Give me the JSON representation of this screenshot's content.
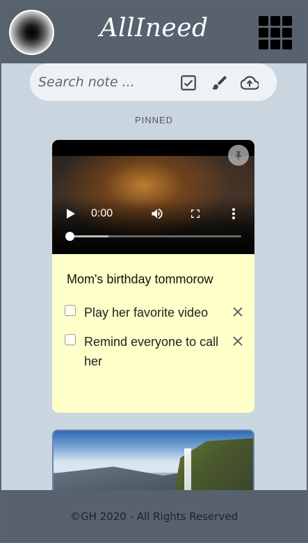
{
  "header": {
    "brand": "AllIneed",
    "avatar_icon": "avatar-image",
    "apps_icon": "grid-apps-icon"
  },
  "search": {
    "placeholder": "Search note ...",
    "actions": [
      "checkbox-note-icon",
      "brush-icon",
      "cloud-upload-icon"
    ]
  },
  "section": {
    "pinned_label": "PINNED"
  },
  "note": {
    "video": {
      "time": "0:00",
      "progress_fraction": 0.0,
      "buffered_fraction": 0.23
    },
    "pin_icon": "pin-icon",
    "title": "Mom's birthday tommorow",
    "items": [
      {
        "text": "Play her favorite video",
        "checked": false
      },
      {
        "text": "Remind everyone to call her",
        "checked": false
      }
    ],
    "background": "#ffffc9"
  },
  "footer": {
    "copyright": "©GH 2020 - All Rights Reserved"
  },
  "colors": {
    "header_bg": "#57626e",
    "page_bg": "#c9d5df",
    "search_bg": "#eef2f6",
    "note_bg": "#ffffc9"
  }
}
